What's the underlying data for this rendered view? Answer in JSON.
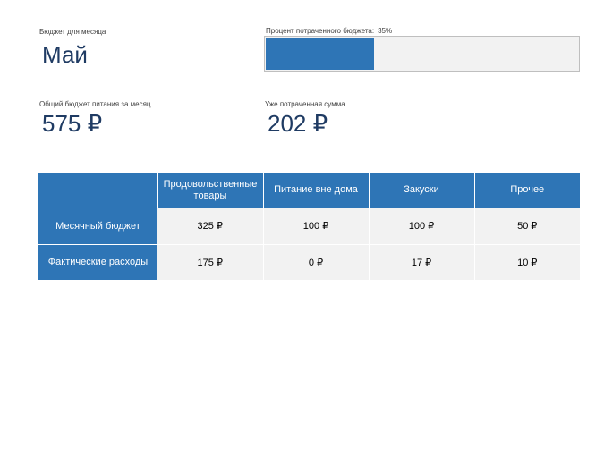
{
  "month": {
    "label": "Бюджет для месяца",
    "value": "Май"
  },
  "progress": {
    "label": "Процент потраченного бюджета:",
    "value_text": "35%",
    "fraction": 0.35
  },
  "total": {
    "label": "Общий бюджет питания за месяц",
    "value": "575 ₽"
  },
  "spent": {
    "label": "Уже потраченная сумма",
    "value": "202 ₽"
  },
  "table": {
    "headers": [
      "",
      "Продовольственные товары",
      "Питание вне дома",
      "Закуски",
      "Прочее"
    ],
    "rows": [
      {
        "label": "Месячный бюджет",
        "cells": [
          "325 ₽",
          "100 ₽",
          "100 ₽",
          "50 ₽"
        ]
      },
      {
        "label": "Фактические расходы",
        "cells": [
          "175 ₽",
          "0 ₽",
          "17 ₽",
          "10 ₽"
        ]
      }
    ]
  },
  "colors": {
    "accent": "#2e75b6",
    "title_text": "#1f3b63",
    "cell_bg": "#f2f2f2"
  }
}
